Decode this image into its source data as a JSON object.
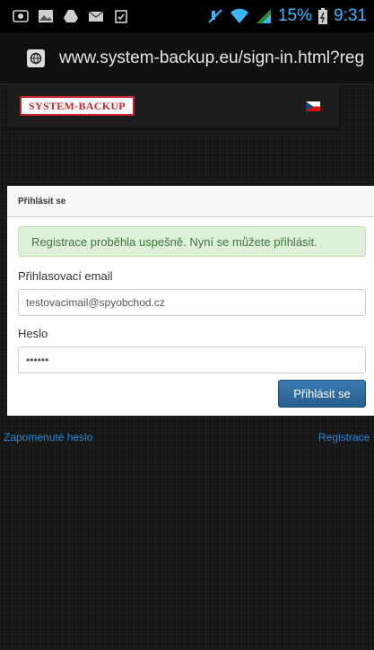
{
  "status_bar": {
    "battery_percent": "15%",
    "time": "9:31",
    "icons": [
      "screenshot-icon",
      "gallery-icon",
      "drive-icon",
      "mail-icon",
      "clipboard-icon",
      "mute-icon",
      "wifi-icon",
      "signal-icon",
      "battery-icon"
    ]
  },
  "browser": {
    "url": "www.system-backup.eu/sign-in.html?reg",
    "site_icon": "browser-site-icon"
  },
  "site": {
    "logo_text": "SYSTEM-BACKUP",
    "language_flag": "czech-flag-icon"
  },
  "login": {
    "title": "Přihlásit se",
    "success_message": "Registrace proběhla uspešně. Nyní se můžete přihlásit.",
    "email_label": "Přihlasovací email",
    "email_value": "testovacimail@spyobchod.cz",
    "password_label": "Heslo",
    "password_value": "••••••",
    "submit_label": "Přihlásit se"
  },
  "links": {
    "forgot_password": "Zapomenuté heslo",
    "register": "Registrace"
  },
  "colors": {
    "accent": "#39b6ff",
    "button": "#2e6da4",
    "alert_bg": "#dff0d8",
    "alert_text": "#3c763d",
    "link": "#2a87d6",
    "logo_red": "#c8242b"
  }
}
